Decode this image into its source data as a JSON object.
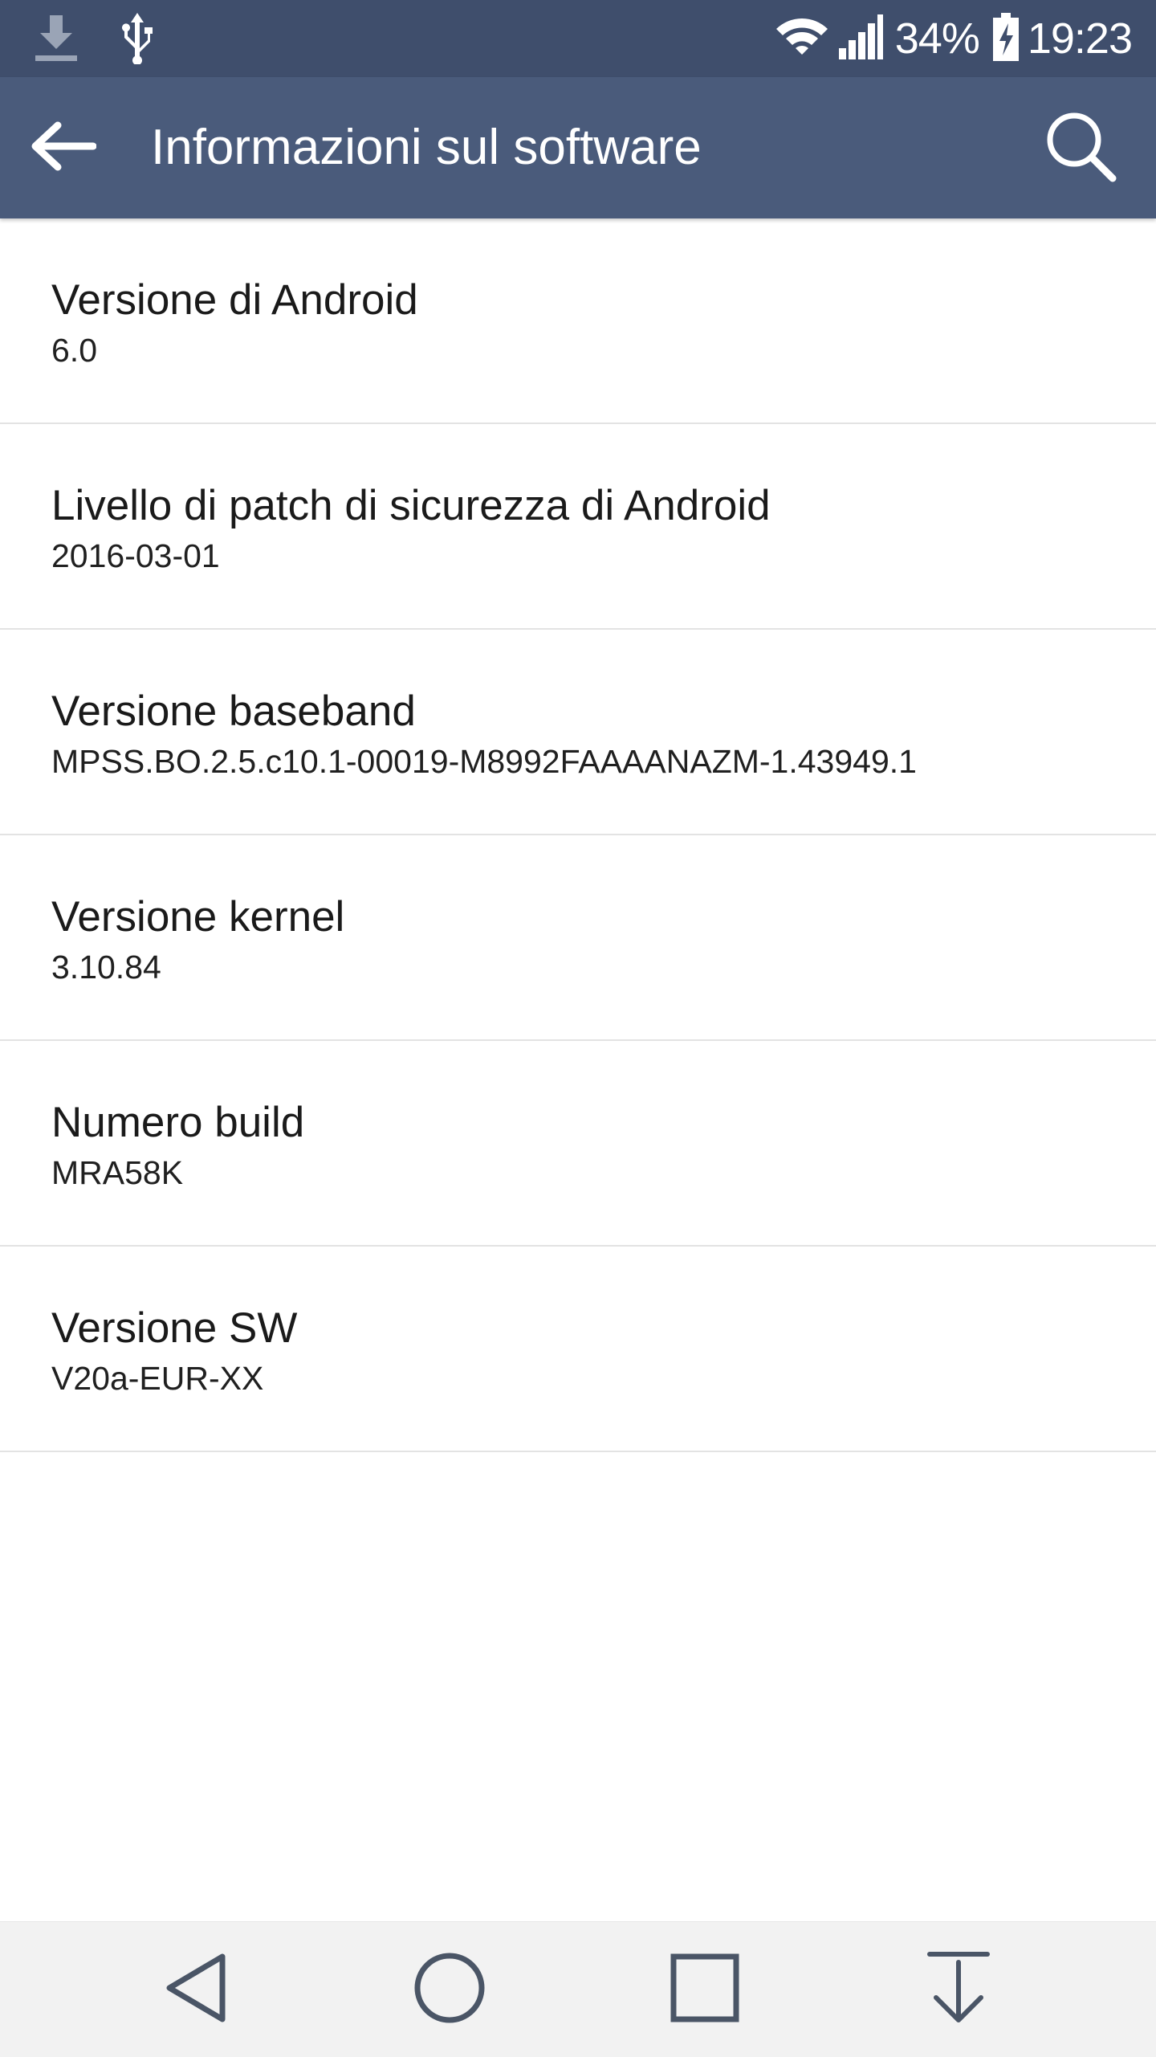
{
  "status_bar": {
    "left_icons": [
      "download-icon",
      "usb-icon"
    ],
    "right_icons": [
      "wifi-icon",
      "signal-icon",
      "battery-charging-icon"
    ],
    "battery_percent": "34%",
    "time": "19:23"
  },
  "app_bar": {
    "title": "Informazioni sul software",
    "back_icon": "arrow-left-icon",
    "search_icon": "search-icon"
  },
  "items": [
    {
      "title": "Versione di Android",
      "value": "6.0"
    },
    {
      "title": "Livello di patch di sicurezza di Android",
      "value": "2016-03-01"
    },
    {
      "title": "Versione baseband",
      "value": "MPSS.BO.2.5.c10.1-00019-M8992FAAAANAZM-1.43949.1"
    },
    {
      "title": "Versione kernel",
      "value": "3.10.84"
    },
    {
      "title": "Numero build",
      "value": "MRA58K"
    },
    {
      "title": "Versione SW",
      "value": "V20a-EUR-XX"
    }
  ],
  "nav_bar": {
    "buttons": [
      "back-triangle-icon",
      "home-circle-icon",
      "recents-square-icon",
      "notification-pulldown-icon"
    ]
  },
  "colors": {
    "status_bar": "#3f4e6c",
    "app_bar": "#4a5b7b",
    "nav_bar": "#f2f2f2",
    "nav_icon": "#4a5566",
    "divider": "#e3e3e3"
  }
}
